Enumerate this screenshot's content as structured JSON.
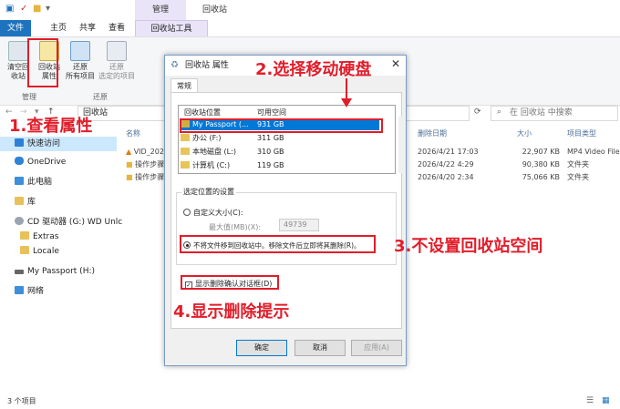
{
  "titlebar": {
    "manage_tab": "管理",
    "title": "回收站"
  },
  "tabs": {
    "file": "文件",
    "home": "主页",
    "share": "共享",
    "view": "查看",
    "tools": "回收站工具"
  },
  "ribbon": {
    "empty_label": "清空回\n收站",
    "props_label": "回收站\n属性",
    "restore_all_label": "还原\n所有项目",
    "restore_sel_label": "还原\n选定的项目",
    "group_manage": "管理",
    "group_restore": "还原"
  },
  "address": {
    "path": "回收站",
    "search_placeholder": "在 回收站 中搜索"
  },
  "nav": {
    "quick": "快速访问",
    "onedrive": "OneDrive",
    "pc": "此电脑",
    "lib": "库",
    "cd": "CD 驱动器 (G:) WD Unlc",
    "extras": "Extras",
    "locale": "Locale",
    "passport": "My Passport (H:)",
    "network": "网络"
  },
  "list": {
    "col_name": "名称",
    "col_date": "删除日期",
    "col_size": "大小",
    "col_type": "项目类型",
    "rows": [
      {
        "name": "VID_202",
        "date": "2026/4/21 17:03",
        "size": "22,907 KB",
        "type": "MP4 Video File"
      },
      {
        "name": "操作步骤",
        "date": "2026/4/22 4:29",
        "size": "90,380 KB",
        "type": "文件夹"
      },
      {
        "name": "操作步骤",
        "date": "2026/4/20 2:34",
        "size": "75,066 KB",
        "type": "文件夹"
      }
    ]
  },
  "status": {
    "count": "3 个项目"
  },
  "dialog": {
    "title": "回收站 属性",
    "tab": "常规",
    "col_location": "回收站位置",
    "col_space": "可用空间",
    "locations": [
      {
        "name": "My Passport (...",
        "space": "931 GB"
      },
      {
        "name": "办公 (F:)",
        "space": "311 GB"
      },
      {
        "name": "本地磁盘 (L:)",
        "space": "310 GB"
      },
      {
        "name": "计算机 (C:)",
        "space": "119 GB"
      }
    ],
    "settings_legend": "选定位置的设置",
    "custom_size": "自定义大小(C):",
    "max_label": "最大值(MB)(X):",
    "max_value": "49739",
    "no_move": "不将文件移到回收站中。移除文件后立即将其删除(R)。",
    "confirm": "显示删除确认对话框(D)",
    "ok": "确定",
    "cancel": "取消",
    "apply": "应用(A)"
  },
  "annotations": {
    "a1": "1.查看属性",
    "a2": "2.选择移动硬盘",
    "a3": "3.不设置回收站空间",
    "a4": "4.显示删除提示"
  },
  "colors": {
    "accent": "#1e73be",
    "annotation": "#e11d2a",
    "select": "#0078d7"
  }
}
